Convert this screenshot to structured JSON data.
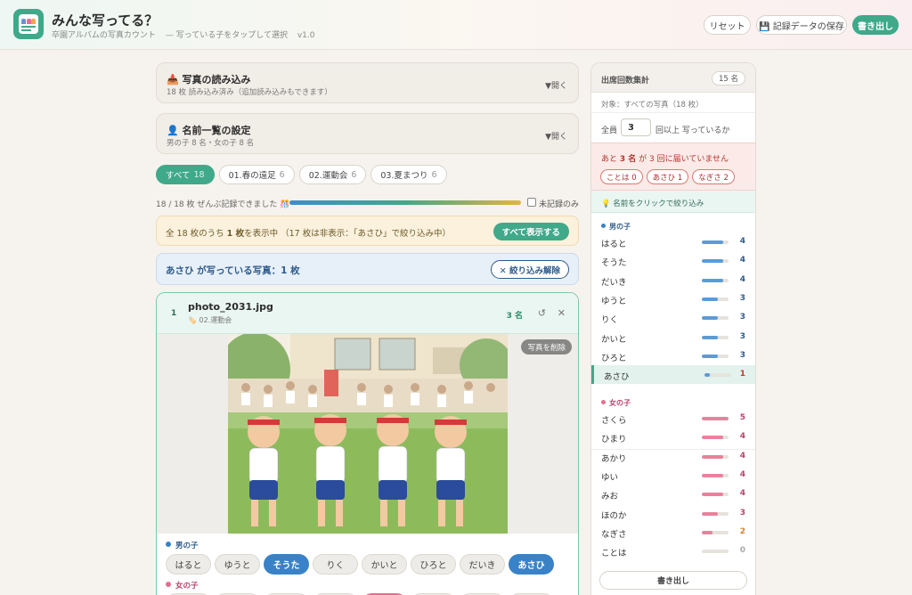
{
  "header": {
    "title": "みんな写ってる？",
    "subtitle": "卒園アルバムの写真カウント",
    "subtitle_hint": "— 写っている子をタップして選択",
    "version": "v1.0",
    "buttons": {
      "reset": "リセット",
      "save": "💾 記録データの保存",
      "export": "書き出し"
    }
  },
  "load_card": {
    "title": "📥 写真の読み込み",
    "subtitle": "18 枚 読み込み済み（追加読み込みもできます）",
    "toggle": "▼開く"
  },
  "names_card": {
    "title": "👤 名前一覧の設定",
    "subtitle": "男の子 8 名・女の子 8 名",
    "toggle": "▼開く"
  },
  "tabs": [
    {
      "label": "すべて",
      "count": "18",
      "active": true
    },
    {
      "label": "01.春の遠足",
      "count": "6",
      "active": false
    },
    {
      "label": "02.運動会",
      "count": "6",
      "active": false
    },
    {
      "label": "03.夏まつり",
      "count": "6",
      "active": false
    }
  ],
  "progress": {
    "text": "18 / 18 枚 ぜんぶ記録できました 🎊",
    "fraction": 1.0,
    "unrecorded_label": "未記録のみ"
  },
  "notice": {
    "text_pre": "全 18 枚のうち ",
    "text_bold": "1 枚",
    "text_post": "を表示中 （17 枚は非表示：「あさひ」で絞り込み中）",
    "button": "すべて表示する"
  },
  "filter": {
    "text": "あさひ が写っている写真：1 枚",
    "clear_button": "✕ 絞り込み解除"
  },
  "photo": {
    "index": "1",
    "filename": "photo_2031.jpg",
    "tag": "🏷️ 02.運動会",
    "people_count": "3 名",
    "rotate_icon": "↺",
    "close_icon": "✕",
    "delete_button": "写真を削除",
    "boys_label": "男の子",
    "girls_label": "女の子",
    "boys": [
      {
        "name": "はると",
        "selected": false
      },
      {
        "name": "ゆうと",
        "selected": false
      },
      {
        "name": "そうた",
        "selected": true
      },
      {
        "name": "りく",
        "selected": false
      },
      {
        "name": "かいと",
        "selected": false
      },
      {
        "name": "ひろと",
        "selected": false
      },
      {
        "name": "だいき",
        "selected": false
      },
      {
        "name": "あさひ",
        "selected": true
      }
    ]
  },
  "panel": {
    "title": "出席回数集計",
    "member_count": "15 名",
    "target": "対象：すべての写真（18 枚）",
    "all_label": "全員",
    "threshold": "3",
    "threshold_suffix": "回以上 写っているか",
    "warn_pre": "あと ",
    "warn_bold": "3 名",
    "warn_post": " が 3 回に届いていません",
    "warn_names": [
      "ことは 0",
      "あさひ 1",
      "なぎさ 2"
    ],
    "hint": "💡 名前をクリックで絞り込み",
    "boys_label": "男の子",
    "girls_label": "女の子",
    "max_count": 5,
    "boys": [
      {
        "name": "はると",
        "count": 4
      },
      {
        "name": "そうた",
        "count": 4
      },
      {
        "name": "だいき",
        "count": 4
      },
      {
        "name": "ゆうと",
        "count": 3
      },
      {
        "name": "りく",
        "count": 3
      },
      {
        "name": "かいと",
        "count": 3
      },
      {
        "name": "ひろと",
        "count": 3
      },
      {
        "name": "あさひ",
        "count": 1,
        "highlight": true
      }
    ],
    "girls": [
      {
        "name": "さくら",
        "count": 5
      },
      {
        "name": "ひまり",
        "count": 4
      },
      {
        "name": "あかり",
        "count": 4
      },
      {
        "name": "ゆい",
        "count": 4
      },
      {
        "name": "みお",
        "count": 4
      },
      {
        "name": "ほのか",
        "count": 3
      },
      {
        "name": "なぎさ",
        "count": 2
      },
      {
        "name": "ことは",
        "count": 0
      }
    ],
    "export_button": "書き出し"
  },
  "colors": {
    "accent": "#3fa98a",
    "boy": "#3a82c7",
    "girl": "#e46f8e",
    "warn": "#c0392b",
    "caution": "#d9822b",
    "ok": "#2f5b8a"
  }
}
